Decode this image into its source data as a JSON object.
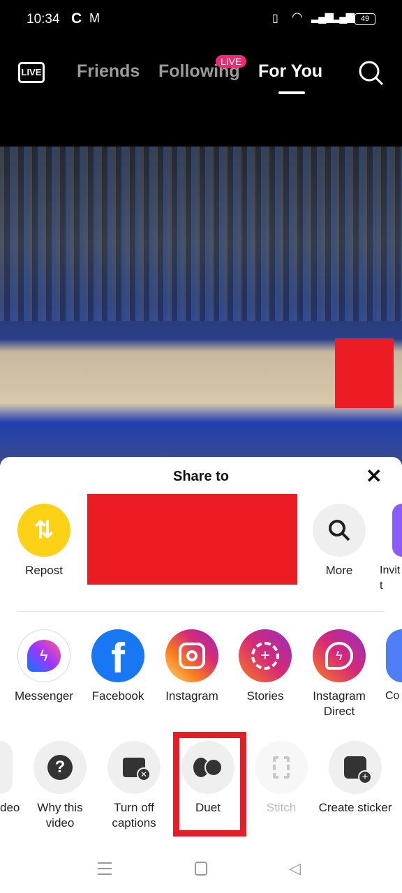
{
  "status_bar": {
    "time": "10:34",
    "battery": "49"
  },
  "top_nav": {
    "live_icon_label": "LIVE",
    "tabs": [
      {
        "label": "Friends"
      },
      {
        "label": "Following",
        "badge": "LIVE"
      },
      {
        "label": "For You",
        "active": true
      }
    ]
  },
  "share_sheet": {
    "title": "Share to",
    "row1": [
      {
        "label": "Repost",
        "icon": "repost-icon",
        "color": "#fcd116"
      },
      {
        "label": "More",
        "icon": "search-icon"
      },
      {
        "label": "Invit\nt",
        "icon": "invite-icon",
        "color": "#8b5cf6"
      }
    ],
    "row2": [
      {
        "label": "Messenger"
      },
      {
        "label": "Facebook"
      },
      {
        "label": "Instagram"
      },
      {
        "label": "Stories"
      },
      {
        "label": "Instagram Direct"
      },
      {
        "label": "Co"
      }
    ],
    "row3": [
      {
        "label": "deo"
      },
      {
        "label": "Why this video"
      },
      {
        "label": "Turn off captions"
      },
      {
        "label": "Duet",
        "highlighted": true
      },
      {
        "label": "Stitch",
        "disabled": true
      },
      {
        "label": "Create sticker"
      }
    ]
  },
  "colors": {
    "highlight": "#e41e26",
    "live_badge": "#ee2a72",
    "facebook": "#1877f2"
  }
}
